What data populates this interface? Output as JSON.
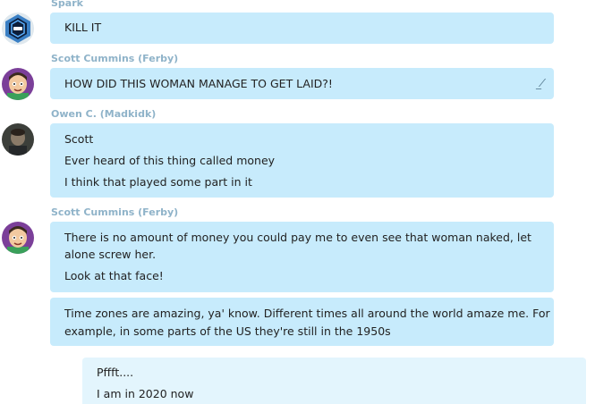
{
  "messages": [
    {
      "sender": "Spark",
      "avatar_icon": "hexagon-logo-icon",
      "lines": [
        "KILL IT"
      ]
    },
    {
      "sender": "Scott Cummins (Ferby)",
      "avatar_icon": "cartoon-face-icon",
      "lines": [
        "HOW DID THIS WOMAN MANAGE TO GET LAID?!"
      ],
      "edit_icon": "_⁄"
    },
    {
      "sender": "Owen C. (Madkidk)",
      "avatar_icon": "photo-avatar-icon",
      "lines": [
        "Scott",
        "Ever heard of this thing called money",
        "I think that played some part in it"
      ]
    },
    {
      "sender": "Scott Cummins (Ferby)",
      "avatar_icon": "cartoon-face-icon",
      "lines": [
        "There is no amount of money you could pay me to even see that woman naked, let",
        "alone screw her.",
        "Look at that face!"
      ]
    },
    {
      "lines": [
        "Time zones are amazing, ya' know. Different times all around the world amaze me. For",
        "example, in some parts of the US they're still in the 1950s"
      ]
    },
    {
      "own": true,
      "lines": [
        "Pffft....",
        "I am in 2020 now"
      ]
    }
  ],
  "colors": {
    "bubble": "#c7ebfc",
    "own_bubble": "#e3f5fd",
    "sender_name": "#8fb3c9"
  }
}
